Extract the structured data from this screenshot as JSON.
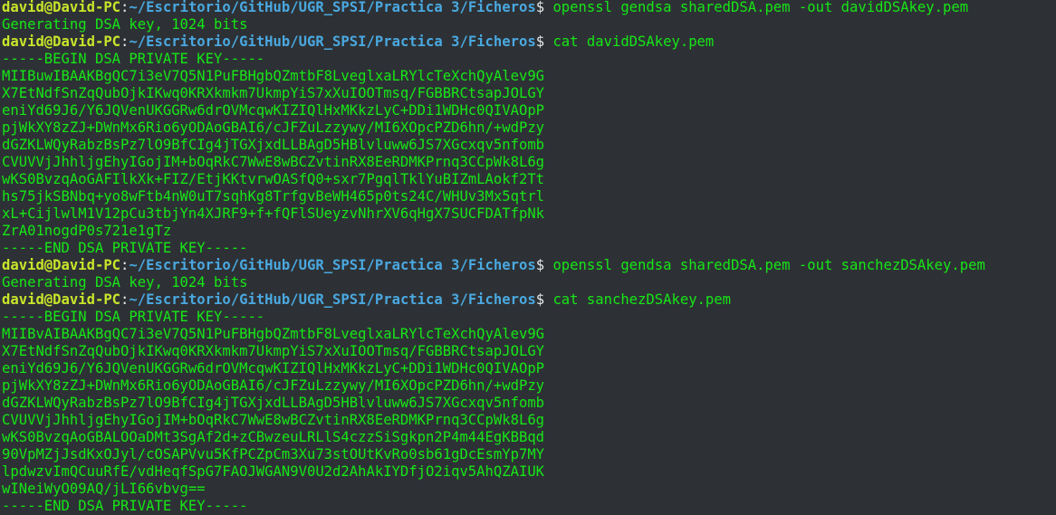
{
  "colors": {
    "background": "#2d3135",
    "user_host": "#c9e52a",
    "path": "#4aa8e0",
    "output": "#17e617"
  },
  "prompt": {
    "user_host": "david@David-PC",
    "separator": ":",
    "path": "~/Escritorio/GitHub/UGR_SPSI/Practica 3/Ficheros",
    "symbol": "$ "
  },
  "lines": [
    {
      "type": "prompt",
      "command": "openssl gendsa sharedDSA.pem -out davidDSAkey.pem"
    },
    {
      "type": "output",
      "text": "Generating DSA key, 1024 bits"
    },
    {
      "type": "prompt",
      "command": "cat davidDSAkey.pem"
    },
    {
      "type": "output",
      "text": "-----BEGIN DSA PRIVATE KEY-----"
    },
    {
      "type": "output",
      "text": "MIIBuwIBAAKBgQC7i3eV7Q5N1PuFBHgbQZmtbF8LveglxaLRYlcTeXchQyAlev9G"
    },
    {
      "type": "output",
      "text": "X7EtNdfSnZqQubOjkIKwq0KRXkmkm7UkmpYiS7xXuIOOTmsq/FGBBRCtsapJOLGY"
    },
    {
      "type": "output",
      "text": "eniYd69J6/Y6JQVenUKGGRw6drOVMcqwKIZIQlHxMKkzLyC+DDi1WDHc0QIVAOpP"
    },
    {
      "type": "output",
      "text": "pjWkXY8zZJ+DWnMx6Rio6yODAoGBAI6/cJFZuLzzywy/MI6XOpcPZD6hn/+wdPzy"
    },
    {
      "type": "output",
      "text": "dGZKLWQyRabzBsPz7lO9BfCIg4jTGXjxdLLBAgD5HBlvluww6JS7XGcxqv5nfomb"
    },
    {
      "type": "output",
      "text": "CVUVVjJhhljgEhyIGojIM+bOqRkC7WwE8wBCZvtinRX8EeRDMKPrnq3CCpWk8L6g"
    },
    {
      "type": "output",
      "text": "wKS0BvzqAoGAFIlkXk+FIZ/EtjKKtvrwOASfQ0+sxr7PgqlTklYuBIZmLAokf2Tt"
    },
    {
      "type": "output",
      "text": "hs75jkSBNbq+yo8wFtb4nW0uT7sqhKg8TrfgvBeWH465p0ts24C/WHUv3Mx5qtrl"
    },
    {
      "type": "output",
      "text": "xL+CijlwlM1V12pCu3tbjYn4XJRF9+f+fQFlSUeyzvNhrXV6qHgX7SUCFDATfpNk"
    },
    {
      "type": "output",
      "text": "ZrA01nogdP0s721e1gTz"
    },
    {
      "type": "output",
      "text": "-----END DSA PRIVATE KEY-----"
    },
    {
      "type": "prompt",
      "command": "openssl gendsa sharedDSA.pem -out sanchezDSAkey.pem"
    },
    {
      "type": "output",
      "text": "Generating DSA key, 1024 bits"
    },
    {
      "type": "prompt",
      "command": "cat sanchezDSAkey.pem"
    },
    {
      "type": "output",
      "text": "-----BEGIN DSA PRIVATE KEY-----"
    },
    {
      "type": "output",
      "text": "MIIBvAIBAAKBgQC7i3eV7Q5N1PuFBHgbQZmtbF8LveglxaLRYlcTeXchQyAlev9G"
    },
    {
      "type": "output",
      "text": "X7EtNdfSnZqQubOjkIKwq0KRXkmkm7UkmpYiS7xXuIOOTmsq/FGBBRCtsapJOLGY"
    },
    {
      "type": "output",
      "text": "eniYd69J6/Y6JQVenUKGGRw6drOVMcqwKIZIQlHxMKkzLyC+DDi1WDHc0QIVAOpP"
    },
    {
      "type": "output",
      "text": "pjWkXY8zZJ+DWnMx6Rio6yODAoGBAI6/cJFZuLzzywy/MI6XOpcPZD6hn/+wdPzy"
    },
    {
      "type": "output",
      "text": "dGZKLWQyRabzBsPz7lO9BfCIg4jTGXjxdLLBAgD5HBlvluww6JS7XGcxqv5nfomb"
    },
    {
      "type": "output",
      "text": "CVUVVjJhhljgEhyIGojIM+bOqRkC7WwE8wBCZvtinRX8EeRDMKPrnq3CCpWk8L6g"
    },
    {
      "type": "output",
      "text": "wKS0BvzqAoGBALOOaDMt3SgAf2d+zCBwzeuLRLlS4czzSiSgkpn2P4m44EgKBBqd"
    },
    {
      "type": "output",
      "text": "90VpMZjJsdKxOJyl/cOSAPVvu5KfPCZpCm3Xu73stOUtKvRo0sb61gDcEsmYp7MY"
    },
    {
      "type": "output",
      "text": "lpdwzvImQCuuRfE/vdHeqfSpG7FAOJWGAN9V0U2d2AhAkIYDfjO2iqv5AhQZAIUK"
    },
    {
      "type": "output",
      "text": "wINeiWyO09AQ/jLI66vbvg=="
    },
    {
      "type": "output",
      "text": "-----END DSA PRIVATE KEY-----"
    }
  ]
}
